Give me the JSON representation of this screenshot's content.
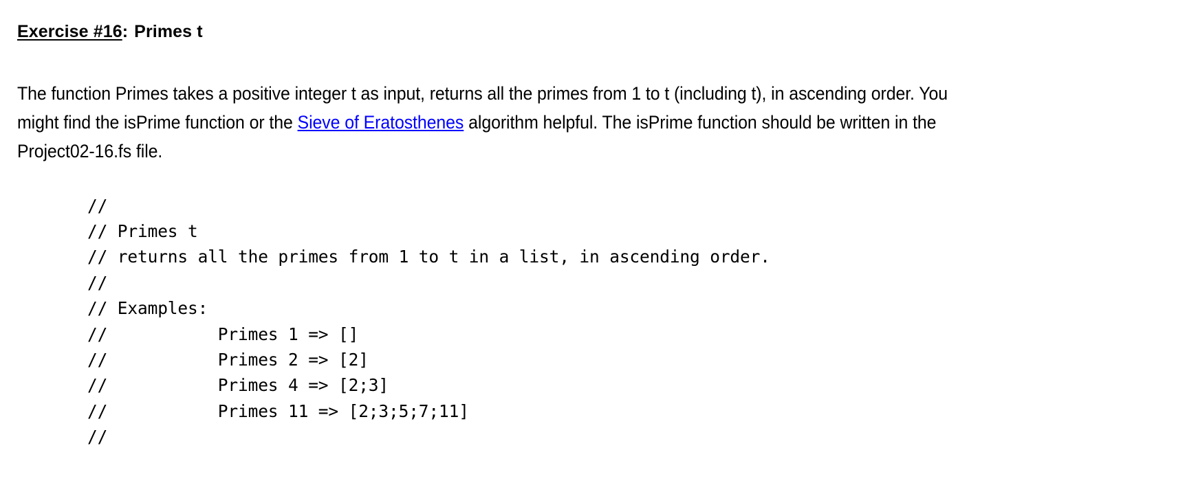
{
  "heading": {
    "exercise_label": "Exercise #16",
    "colon": ":",
    "title": "Primes t"
  },
  "body": {
    "segment_1": "The function Primes takes a positive integer t as input, returns all the primes from 1 to t (including t), in ascending order. You might find the isPrime function or the ",
    "link_text": "Sieve of Eratosthenes",
    "segment_2": " algorithm helpful. The isPrime function should be written in the Project02-16.fs file.",
    "link_color": "#0000FF"
  },
  "code": {
    "lines": [
      "//",
      "// Primes t",
      "// returns all the primes from 1 to t in a list, in ascending order.",
      "//",
      "// Examples:",
      "//           Primes 1 => []",
      "//           Primes 2 => [2]",
      "//           Primes 4 => [2;3]",
      "//           Primes 11 => [2;3;5;7;11]",
      "//"
    ]
  }
}
